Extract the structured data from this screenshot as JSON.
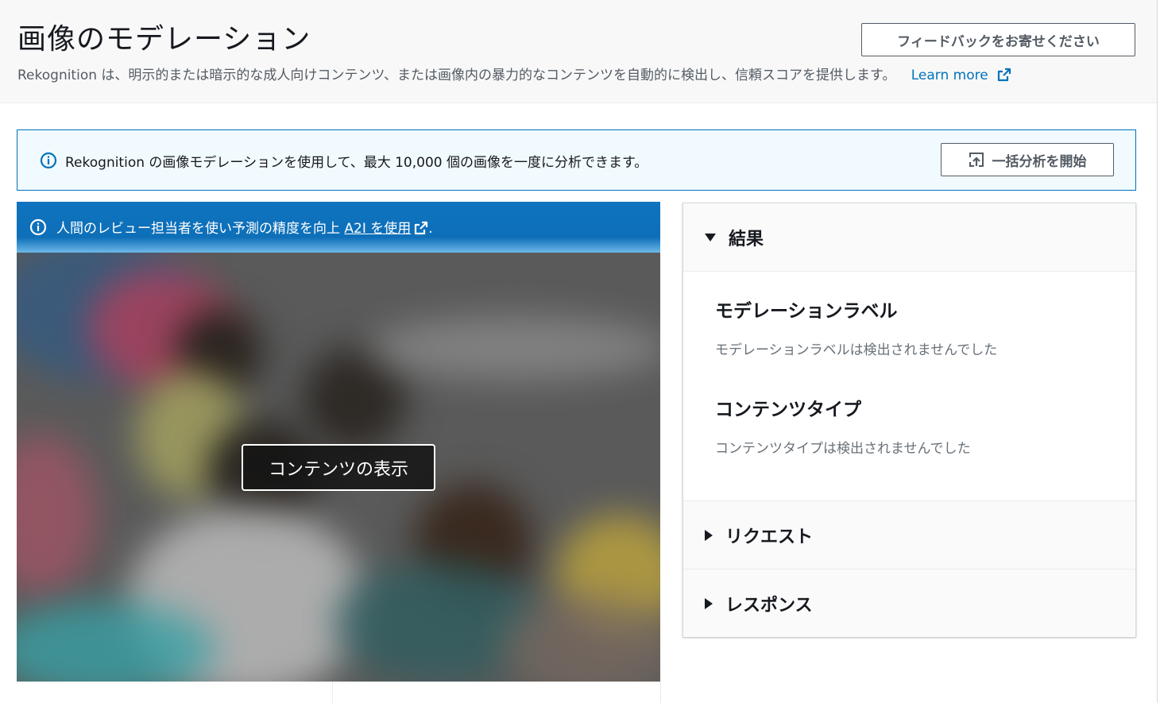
{
  "header": {
    "title": "画像のモデレーション",
    "description": "Rekognition は、明示的または暗示的な成人向けコンテンツ、または画像内の暴力的なコンテンツを自動的に検出し、信頼スコアを提供します。",
    "learn_more": "Learn more",
    "feedback_button": "フィードバックをお寄せください"
  },
  "info_flash": {
    "text": "Rekognition の画像モデレーションを使用して、最大 10,000 個の画像を一度に分析できます。",
    "batch_button": "一括分析を開始"
  },
  "image_panel": {
    "a2i_text": "人間のレビュー担当者を使い予測の精度を向上",
    "a2i_link": "A2I を使用",
    "a2i_suffix": ".",
    "view_content_button": "コンテンツの表示"
  },
  "results": {
    "title": "結果",
    "moderation_label_heading": "モデレーションラベル",
    "moderation_label_text": "モデレーションラベルは検出されませんでした",
    "content_type_heading": "コンテンツタイプ",
    "content_type_text": "コンテンツタイプは検出されませんでした"
  },
  "request": {
    "title": "リクエスト"
  },
  "response": {
    "title": "レスポンス"
  },
  "colors": {
    "link": "#0073bb",
    "banner": "#0f73bf",
    "flash_bg": "#f1faff",
    "text": "#16191f",
    "muted": "#687078"
  },
  "icons": [
    "info-icon",
    "external-link-icon",
    "upload-icon",
    "caret-down-icon",
    "caret-right-icon"
  ]
}
